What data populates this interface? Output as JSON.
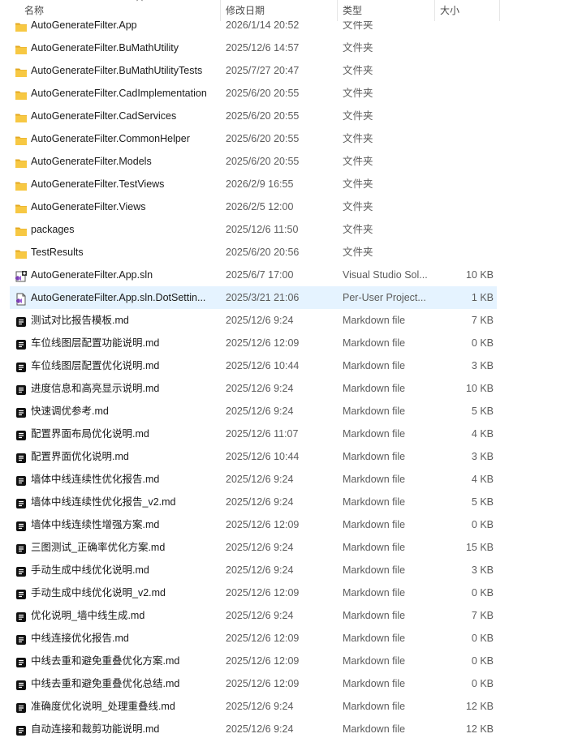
{
  "columns": {
    "name": "名称",
    "date": "修改日期",
    "type": "类型",
    "size": "大小"
  },
  "colors": {
    "folder": "#f7c843",
    "folder_dark": "#e3a923",
    "selection": "#e5f3ff",
    "sln_purple": "#7a3fb3"
  },
  "rows": [
    {
      "icon": "folder-icon",
      "name": "AutoGenerateFilter.App",
      "date": "2026/1/14 20:52",
      "type": "文件夹",
      "size": ""
    },
    {
      "icon": "folder-icon",
      "name": "AutoGenerateFilter.BuMathUtility",
      "date": "2025/12/6 14:57",
      "type": "文件夹",
      "size": ""
    },
    {
      "icon": "folder-icon",
      "name": "AutoGenerateFilter.BuMathUtilityTests",
      "date": "2025/7/27 20:47",
      "type": "文件夹",
      "size": ""
    },
    {
      "icon": "folder-icon",
      "name": "AutoGenerateFilter.CadImplementation",
      "date": "2025/6/20 20:55",
      "type": "文件夹",
      "size": ""
    },
    {
      "icon": "folder-icon",
      "name": "AutoGenerateFilter.CadServices",
      "date": "2025/6/20 20:55",
      "type": "文件夹",
      "size": ""
    },
    {
      "icon": "folder-icon",
      "name": "AutoGenerateFilter.CommonHelper",
      "date": "2025/6/20 20:55",
      "type": "文件夹",
      "size": ""
    },
    {
      "icon": "folder-icon",
      "name": "AutoGenerateFilter.Models",
      "date": "2025/6/20 20:55",
      "type": "文件夹",
      "size": ""
    },
    {
      "icon": "folder-icon",
      "name": "AutoGenerateFilter.TestViews",
      "date": "2026/2/9 16:55",
      "type": "文件夹",
      "size": ""
    },
    {
      "icon": "folder-icon",
      "name": "AutoGenerateFilter.Views",
      "date": "2026/2/5 12:00",
      "type": "文件夹",
      "size": ""
    },
    {
      "icon": "folder-icon",
      "name": "packages",
      "date": "2025/12/6 11:50",
      "type": "文件夹",
      "size": ""
    },
    {
      "icon": "folder-icon",
      "name": "TestResults",
      "date": "2025/6/20 20:56",
      "type": "文件夹",
      "size": ""
    },
    {
      "icon": "visual-studio-solution-icon",
      "name": "AutoGenerateFilter.App.sln",
      "date": "2025/6/7 17:00",
      "type": "Visual Studio Sol...",
      "size": "10 KB"
    },
    {
      "icon": "dotsettings-file-icon",
      "name": "AutoGenerateFilter.App.sln.DotSettin...",
      "date": "2025/3/21 21:06",
      "type": "Per-User Project...",
      "size": "1 KB",
      "selected": true
    },
    {
      "icon": "markdown-file-icon",
      "name": "测试对比报告模板.md",
      "date": "2025/12/6 9:24",
      "type": "Markdown file",
      "size": "7 KB"
    },
    {
      "icon": "markdown-file-icon",
      "name": "车位线图层配置功能说明.md",
      "date": "2025/12/6 12:09",
      "type": "Markdown file",
      "size": "0 KB"
    },
    {
      "icon": "markdown-file-icon",
      "name": "车位线图层配置优化说明.md",
      "date": "2025/12/6 10:44",
      "type": "Markdown file",
      "size": "3 KB"
    },
    {
      "icon": "markdown-file-icon",
      "name": "进度信息和高亮显示说明.md",
      "date": "2025/12/6 9:24",
      "type": "Markdown file",
      "size": "10 KB"
    },
    {
      "icon": "markdown-file-icon",
      "name": "快速调优参考.md",
      "date": "2025/12/6 9:24",
      "type": "Markdown file",
      "size": "5 KB"
    },
    {
      "icon": "markdown-file-icon",
      "name": "配置界面布局优化说明.md",
      "date": "2025/12/6 11:07",
      "type": "Markdown file",
      "size": "4 KB"
    },
    {
      "icon": "markdown-file-icon",
      "name": "配置界面优化说明.md",
      "date": "2025/12/6 10:44",
      "type": "Markdown file",
      "size": "3 KB"
    },
    {
      "icon": "markdown-file-icon",
      "name": "墙体中线连续性优化报告.md",
      "date": "2025/12/6 9:24",
      "type": "Markdown file",
      "size": "4 KB"
    },
    {
      "icon": "markdown-file-icon",
      "name": "墙体中线连续性优化报告_v2.md",
      "date": "2025/12/6 9:24",
      "type": "Markdown file",
      "size": "5 KB"
    },
    {
      "icon": "markdown-file-icon",
      "name": "墙体中线连续性增强方案.md",
      "date": "2025/12/6 12:09",
      "type": "Markdown file",
      "size": "0 KB"
    },
    {
      "icon": "markdown-file-icon",
      "name": "三图测试_正确率优化方案.md",
      "date": "2025/12/6 9:24",
      "type": "Markdown file",
      "size": "15 KB"
    },
    {
      "icon": "markdown-file-icon",
      "name": "手动生成中线优化说明.md",
      "date": "2025/12/6 9:24",
      "type": "Markdown file",
      "size": "3 KB"
    },
    {
      "icon": "markdown-file-icon",
      "name": "手动生成中线优化说明_v2.md",
      "date": "2025/12/6 12:09",
      "type": "Markdown file",
      "size": "0 KB"
    },
    {
      "icon": "markdown-file-icon",
      "name": "优化说明_墙中线生成.md",
      "date": "2025/12/6 9:24",
      "type": "Markdown file",
      "size": "7 KB"
    },
    {
      "icon": "markdown-file-icon",
      "name": "中线连接优化报告.md",
      "date": "2025/12/6 12:09",
      "type": "Markdown file",
      "size": "0 KB"
    },
    {
      "icon": "markdown-file-icon",
      "name": "中线去重和避免重叠优化方案.md",
      "date": "2025/12/6 12:09",
      "type": "Markdown file",
      "size": "0 KB"
    },
    {
      "icon": "markdown-file-icon",
      "name": "中线去重和避免重叠优化总结.md",
      "date": "2025/12/6 12:09",
      "type": "Markdown file",
      "size": "0 KB"
    },
    {
      "icon": "markdown-file-icon",
      "name": "准确度优化说明_处理重叠线.md",
      "date": "2025/12/6 9:24",
      "type": "Markdown file",
      "size": "12 KB"
    },
    {
      "icon": "markdown-file-icon",
      "name": "自动连接和裁剪功能说明.md",
      "date": "2025/12/6 9:24",
      "type": "Markdown file",
      "size": "12 KB"
    }
  ]
}
